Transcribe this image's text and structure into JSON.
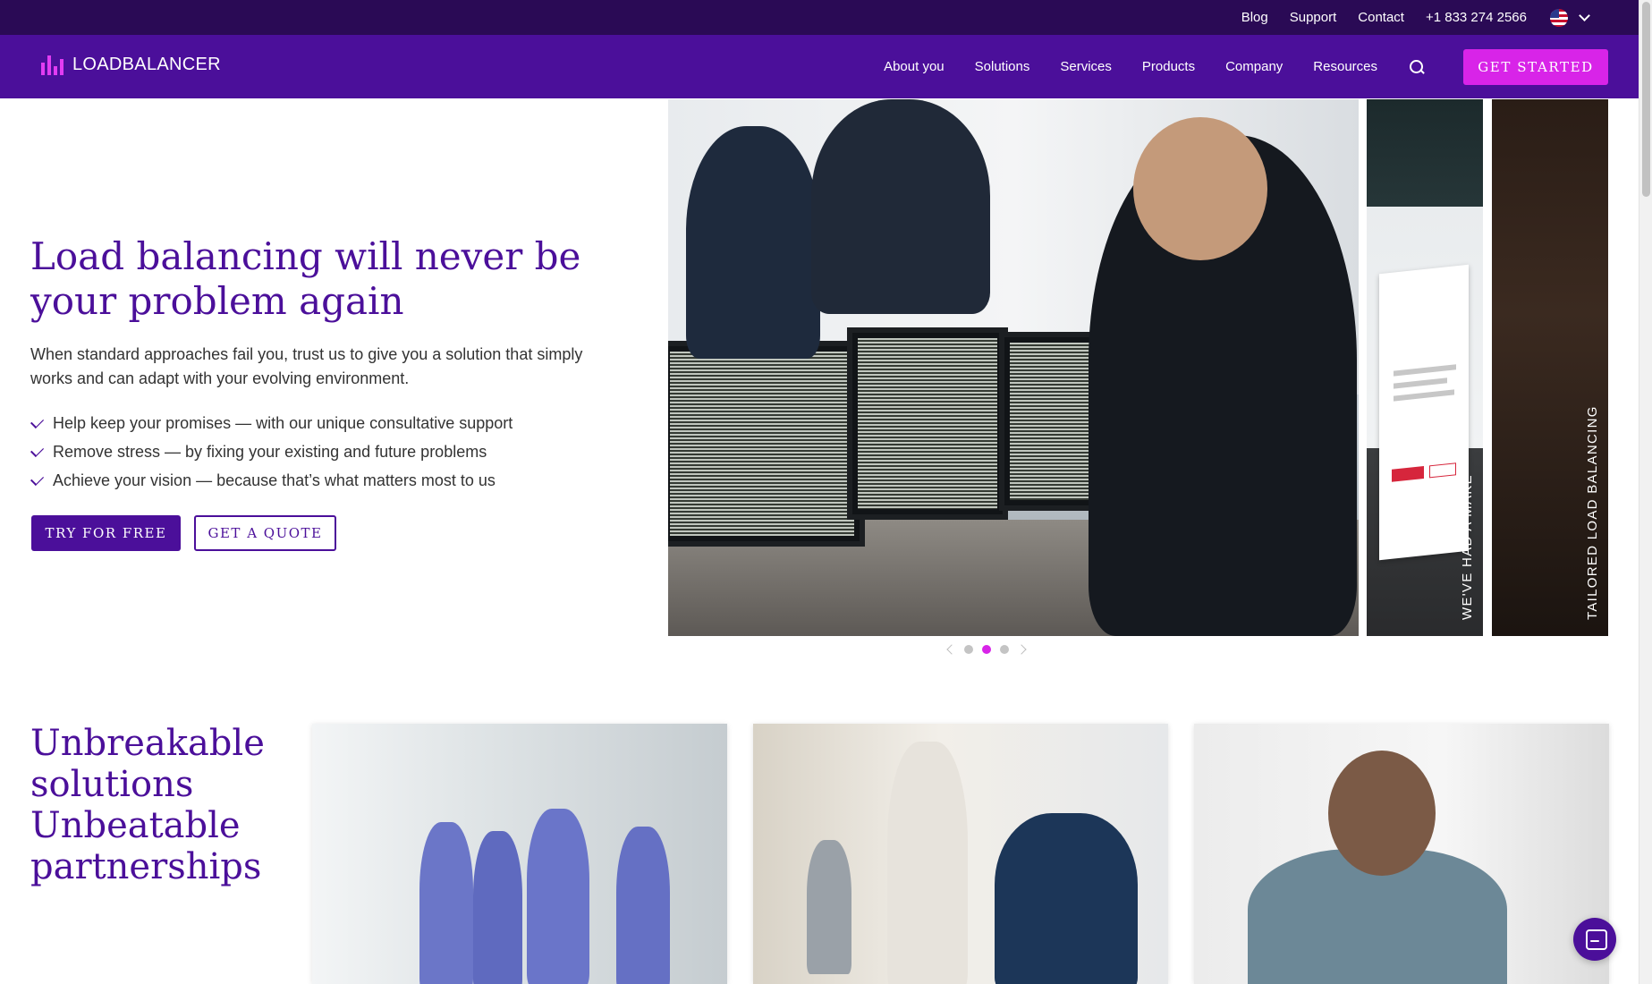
{
  "topbar": {
    "links": [
      "Blog",
      "Support",
      "Contact",
      "+1 833 274 2566"
    ],
    "locale_icon": "us-flag-icon"
  },
  "nav": {
    "logo_text": "LOADBALANCER",
    "items": [
      "About you",
      "Solutions",
      "Services",
      "Products",
      "Company",
      "Resources"
    ],
    "search_icon": "search-icon",
    "cta_label": "GET STARTED"
  },
  "hero": {
    "title": "Load balancing will never be your problem again",
    "description": "When standard approaches fail you, trust us to give you a solution that simply works and can adapt with your evolving environment.",
    "bullets": [
      "Help keep your promises — with our unique consultative support",
      "Remove stress — by fixing your existing and future problems",
      "Achieve your vision — because that’s what matters most to us"
    ],
    "primary_button": "TRY FOR FREE",
    "secondary_button": "GET A QUOTE"
  },
  "carousel": {
    "side_labels": [
      "WE'VE HAD A MAKE",
      "TAILORED LOAD BALANCING"
    ],
    "mock_text": "Load balancing will never be your problem again",
    "dot_count": 3,
    "active_index": 1
  },
  "section2": {
    "title": "Unbreakable solutions Unbeatable partnerships"
  },
  "colors": {
    "topbar": "#2a0a55",
    "nav": "#4b0f9a",
    "accent": "#d824e8",
    "heading": "#4b0f9a"
  }
}
